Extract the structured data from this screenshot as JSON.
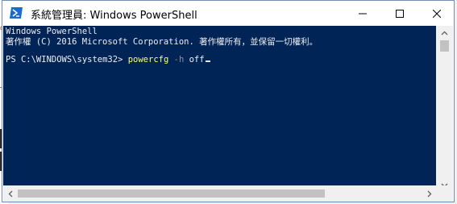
{
  "window": {
    "title": "系統管理員: Windows PowerShell",
    "accent_color": "#012456",
    "icon": "powershell-icon",
    "controls": [
      "minimize-icon",
      "maximize-icon",
      "close-icon"
    ]
  },
  "console": {
    "line1": "Windows PowerShell",
    "line2": "著作權 (C) 2016 Microsoft Corporation. 著作權所有，並保留一切權利。",
    "prompt": "PS C:\\WINDOWS\\system32> ",
    "command": "powercfg",
    "flag": " -h",
    "argument": " off",
    "text_color": "#eeedf0",
    "command_color": "#ffff66",
    "flag_color": "#8f8f8f"
  }
}
